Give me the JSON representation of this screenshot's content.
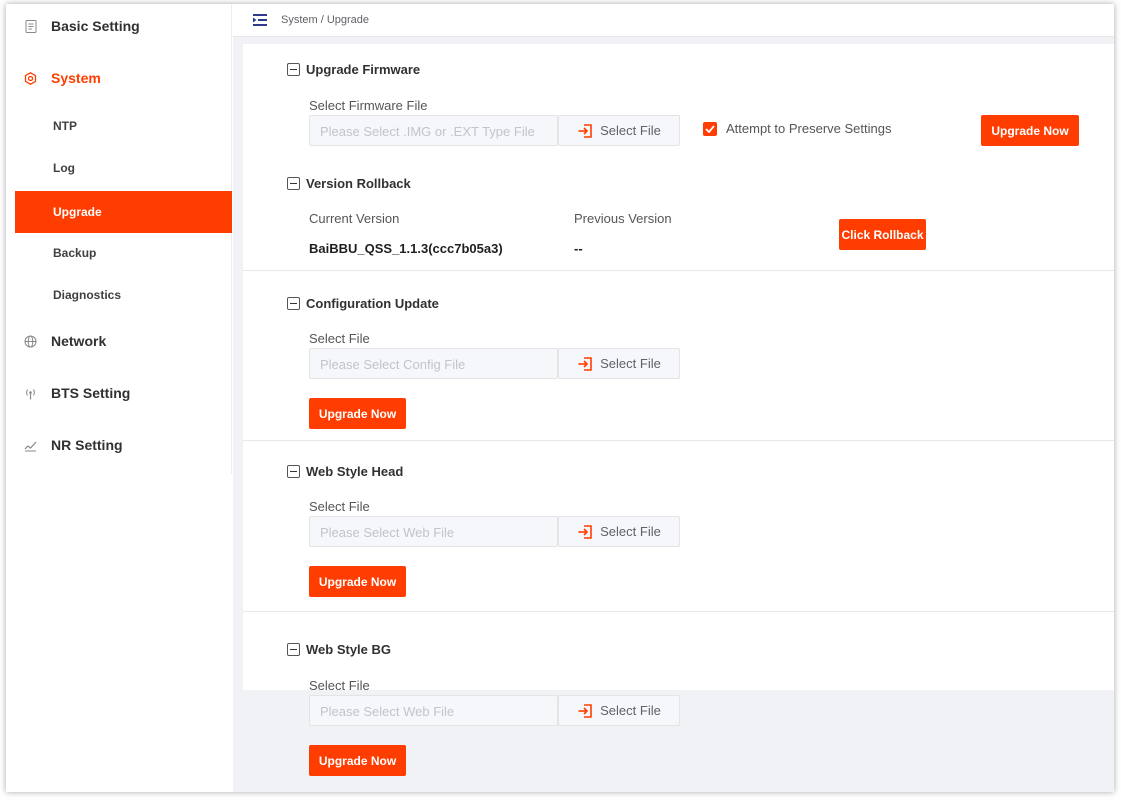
{
  "colors": {
    "accent": "#ff3d00",
    "sidebar_bg": "#ffffff",
    "content_bg": "#f1f2f5"
  },
  "sidebar": {
    "items": [
      {
        "label": "Basic Setting",
        "icon": "document-icon"
      },
      {
        "label": "System",
        "icon": "gear-icon",
        "active": true
      },
      {
        "label": "Network",
        "icon": "globe-icon"
      },
      {
        "label": "BTS Setting",
        "icon": "antenna-icon"
      },
      {
        "label": "NR Setting",
        "icon": "signal-icon"
      }
    ],
    "system_sub": [
      {
        "label": "NTP"
      },
      {
        "label": "Log"
      },
      {
        "label": "Upgrade",
        "active": true
      },
      {
        "label": "Backup"
      },
      {
        "label": "Diagnostics"
      }
    ]
  },
  "breadcrumb": "System / Upgrade",
  "upgrade_firmware": {
    "title": "Upgrade Firmware",
    "file_label": "Select Firmware File",
    "placeholder": "Please Select .IMG or .EXT Type File",
    "select_button": "Select File",
    "preserve_label": "Attempt to Preserve Settings",
    "preserve_checked": true,
    "upgrade_button": "Upgrade Now"
  },
  "version_rollback": {
    "title": "Version Rollback",
    "current_label": "Current Version",
    "current_value": "BaiBBU_QSS_1.1.3(ccc7b05a3)",
    "previous_label": "Previous Version",
    "previous_value": "--",
    "rollback_button": "Click Rollback"
  },
  "config_update": {
    "title": "Configuration Update",
    "file_label": "Select File",
    "placeholder": "Please Select Config File",
    "select_button": "Select File",
    "upgrade_button": "Upgrade Now"
  },
  "web_style_head": {
    "title": "Web Style Head",
    "file_label": "Select File",
    "placeholder": "Please Select Web File",
    "select_button": "Select File",
    "upgrade_button": "Upgrade Now"
  },
  "web_style_bg": {
    "title": "Web Style BG",
    "file_label": "Select File",
    "placeholder": "Please Select Web File",
    "select_button": "Select File",
    "upgrade_button": "Upgrade Now"
  }
}
